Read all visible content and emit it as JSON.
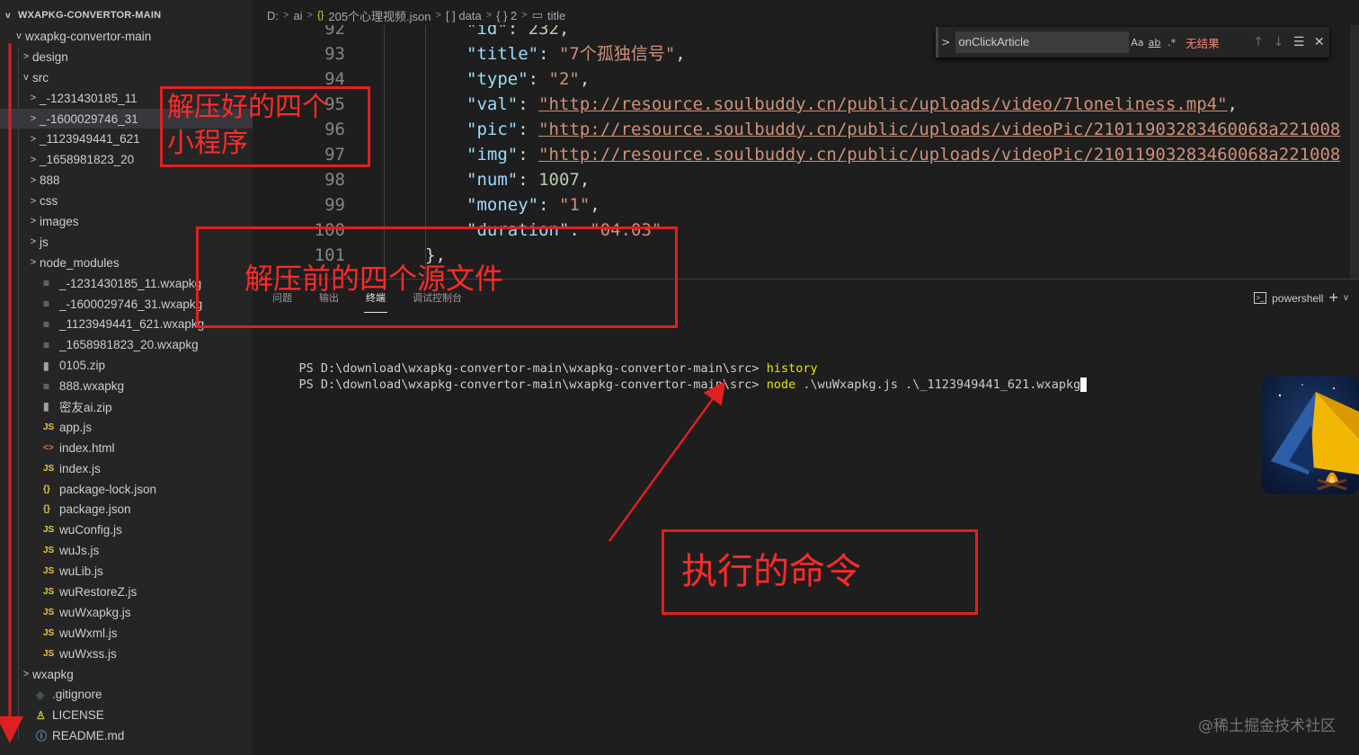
{
  "explorer": {
    "title": "WXAPKG-CONVERTOR-MAIN",
    "items": [
      {
        "label": "wxapkg-convertor-main",
        "icon": "",
        "twistie": "v",
        "depth": 0
      },
      {
        "label": "design",
        "icon": "",
        "twistie": ">",
        "depth": 1
      },
      {
        "label": "src",
        "icon": "",
        "twistie": "v",
        "depth": 1
      },
      {
        "label": "_-1231430185_11",
        "icon": "",
        "twistie": ">",
        "depth": 2
      },
      {
        "label": "_-1600029746_31",
        "icon": "",
        "twistie": ">",
        "depth": 2,
        "selected": true
      },
      {
        "label": "_1123949441_621",
        "icon": "",
        "twistie": ">",
        "depth": 2
      },
      {
        "label": "_1658981823_20",
        "icon": "",
        "twistie": ">",
        "depth": 2
      },
      {
        "label": "888",
        "icon": "",
        "twistie": ">",
        "depth": 2
      },
      {
        "label": "css",
        "icon": "",
        "twistie": ">",
        "depth": 2
      },
      {
        "label": "images",
        "icon": "",
        "twistie": ">",
        "depth": 2
      },
      {
        "label": "js",
        "icon": "",
        "twistie": ">",
        "depth": 2
      },
      {
        "label": "node_modules",
        "icon": "",
        "twistie": ">",
        "depth": 2
      },
      {
        "label": "_-1231430185_11.wxapkg",
        "icon": "≡",
        "icon_kind": "bin",
        "twistie": "",
        "depth": 2
      },
      {
        "label": "_-1600029746_31.wxapkg",
        "icon": "≡",
        "icon_kind": "bin",
        "twistie": "",
        "depth": 2
      },
      {
        "label": "_1123949441_621.wxapkg",
        "icon": "≡",
        "icon_kind": "bin",
        "twistie": "",
        "depth": 2
      },
      {
        "label": "_1658981823_20.wxapkg",
        "icon": "≡",
        "icon_kind": "bin",
        "twistie": "",
        "depth": 2
      },
      {
        "label": "0105.zip",
        "icon": "▮",
        "icon_kind": "zip",
        "twistie": "",
        "depth": 2
      },
      {
        "label": "888.wxapkg",
        "icon": "≡",
        "icon_kind": "bin",
        "twistie": "",
        "depth": 2
      },
      {
        "label": "密友ai.zip",
        "icon": "▮",
        "icon_kind": "zip",
        "twistie": "",
        "depth": 2
      },
      {
        "label": "app.js",
        "icon": "JS",
        "icon_kind": "js",
        "twistie": "",
        "depth": 2
      },
      {
        "label": "index.html",
        "icon": "<>",
        "icon_kind": "html",
        "twistie": "",
        "depth": 2
      },
      {
        "label": "index.js",
        "icon": "JS",
        "icon_kind": "js",
        "twistie": "",
        "depth": 2
      },
      {
        "label": "package-lock.json",
        "icon": "{}",
        "icon_kind": "json",
        "twistie": "",
        "depth": 2
      },
      {
        "label": "package.json",
        "icon": "{}",
        "icon_kind": "json",
        "twistie": "",
        "depth": 2
      },
      {
        "label": "wuConfig.js",
        "icon": "JS",
        "icon_kind": "js",
        "twistie": "",
        "depth": 2
      },
      {
        "label": "wuJs.js",
        "icon": "JS",
        "icon_kind": "js",
        "twistie": "",
        "depth": 2
      },
      {
        "label": "wuLib.js",
        "icon": "JS",
        "icon_kind": "js",
        "twistie": "",
        "depth": 2
      },
      {
        "label": "wuRestoreZ.js",
        "icon": "JS",
        "icon_kind": "js",
        "twistie": "",
        "depth": 2
      },
      {
        "label": "wuWxapkg.js",
        "icon": "JS",
        "icon_kind": "js",
        "twistie": "",
        "depth": 2
      },
      {
        "label": "wuWxml.js",
        "icon": "JS",
        "icon_kind": "js",
        "twistie": "",
        "depth": 2
      },
      {
        "label": "wuWxss.js",
        "icon": "JS",
        "icon_kind": "js",
        "twistie": "",
        "depth": 2
      },
      {
        "label": "wxapkg",
        "icon": "",
        "twistie": ">",
        "depth": 1
      },
      {
        "label": ".gitignore",
        "icon": "◆",
        "icon_kind": "git",
        "twistie": "",
        "depth": 1
      },
      {
        "label": "LICENSE",
        "icon": "♙",
        "icon_kind": "lic",
        "twistie": "",
        "depth": 1
      },
      {
        "label": "README.md",
        "icon": "ⓘ",
        "icon_kind": "info",
        "twistie": "",
        "depth": 1
      }
    ]
  },
  "breadcrumb": {
    "items": [
      "D:",
      "ai",
      "205个心理视频.json",
      "[ ] data",
      "{ } 2",
      "title"
    ]
  },
  "editor": {
    "lines": [
      {
        "num": "92",
        "key": "\"id\"",
        "value": "232",
        "value_type": "num",
        "partial": true
      },
      {
        "num": "93",
        "key": "\"title\"",
        "value": "\"7个孤独信号\"",
        "value_type": "str"
      },
      {
        "num": "94",
        "key": "\"type\"",
        "value": "\"2\"",
        "value_type": "str"
      },
      {
        "num": "95",
        "key": "\"val\"",
        "value": "\"http://resource.soulbuddy.cn/public/uploads/video/7loneliness.mp4\"",
        "value_type": "url"
      },
      {
        "num": "96",
        "key": "\"pic\"",
        "value": "\"http://resource.soulbuddy.cn/public/uploads/videoPic/21011903283460068a221008",
        "value_type": "url",
        "no_comma": true
      },
      {
        "num": "97",
        "key": "\"img\"",
        "value": "\"http://resource.soulbuddy.cn/public/uploads/videoPic/21011903283460068a221008",
        "value_type": "url",
        "no_comma": true
      },
      {
        "num": "98",
        "key": "\"num\"",
        "value": "1007",
        "value_type": "num"
      },
      {
        "num": "99",
        "key": "\"money\"",
        "value": "\"1\"",
        "value_type": "str"
      },
      {
        "num": "100",
        "key": "\"duration\"",
        "value": "\"04:03\"",
        "value_type": "str",
        "no_comma": true
      },
      {
        "num": "101",
        "key": "",
        "value": "},",
        "value_type": "punct"
      }
    ]
  },
  "find": {
    "query": "onClickArticle",
    "match_case": "Aa",
    "whole_word": "ab",
    "regex": ".*",
    "result": "无结果"
  },
  "panel": {
    "tabs": [
      "问题",
      "输出",
      "终端",
      "调试控制台"
    ],
    "active_tab": "终端",
    "shell": "powershell",
    "prompt": "PS D:\\download\\wxapkg-convertor-main\\wxapkg-convertor-main\\src>",
    "commands": [
      "history",
      "node .\\wuWxapkg.js .\\_1123949441_621.wxapkg"
    ]
  },
  "annotations": {
    "box1": "解压好的四个\n小程序",
    "box2": "解压前的四个源文件",
    "box3": "执行的命令",
    "color": "#e02020"
  },
  "watermark": "@稀土掘金技术社区"
}
